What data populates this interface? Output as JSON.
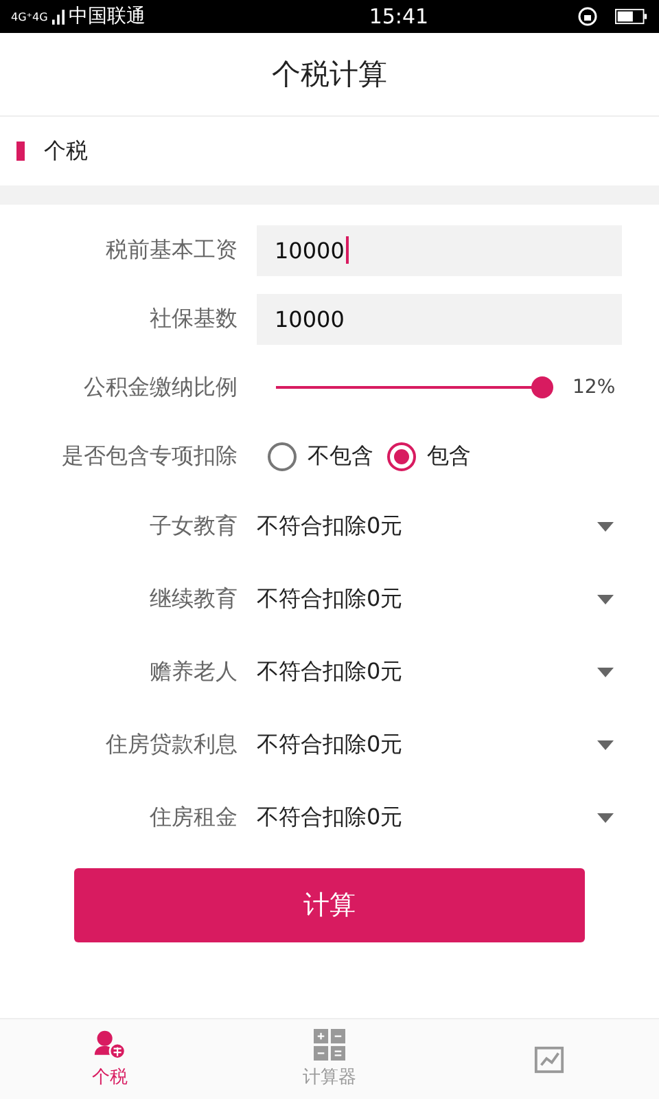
{
  "status_bar": {
    "network": "4G⁺4G",
    "carrier": "中国联通",
    "time": "15:41"
  },
  "title": "个税计算",
  "section": {
    "label": "个税"
  },
  "fields": [
    {
      "label": "税前基本工资",
      "value": "10000",
      "focused": true
    },
    {
      "label": "社保基数",
      "value": "10000",
      "focused": false
    }
  ],
  "housing_fund": {
    "label": "公积金缴纳比例",
    "level": 1,
    "reading": "12%"
  },
  "special_deduction": {
    "label": "是否包含专项扣除",
    "options": [
      {
        "label": "不包含",
        "selected": false
      },
      {
        "label": "包含",
        "selected": true
      }
    ]
  },
  "deductions": [
    {
      "label": "子女教育",
      "value": "不符合扣除0元"
    },
    {
      "label": "继续教育",
      "value": "不符合扣除0元"
    },
    {
      "label": "赡养老人",
      "value": "不符合扣除0元"
    },
    {
      "label": "住房贷款利息",
      "value": "不符合扣除0元"
    },
    {
      "label": "住房租金",
      "value": "不符合扣除0元"
    }
  ],
  "calculate_button": "计算",
  "bottom_nav": [
    {
      "label": "个税",
      "kind": "tax",
      "selected": true
    },
    {
      "label": "计算器",
      "kind": "calculator",
      "selected": false
    },
    {
      "kind": "other",
      "selected": false
    }
  ]
}
